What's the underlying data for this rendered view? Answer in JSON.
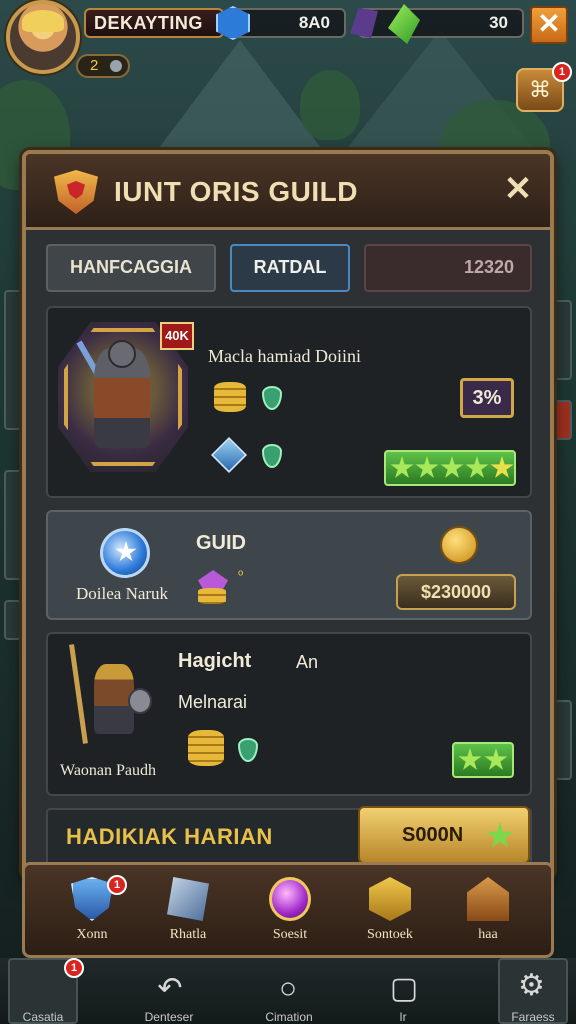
{
  "top_bar": {
    "player_name": "DEKAYTING",
    "level": "2",
    "resource_blue": "8A0",
    "resource_green": "30",
    "close_symbol": "✕",
    "mail_badge": "1"
  },
  "panel": {
    "title": "IUNT ORIS GUILD",
    "close_symbol": "✕",
    "tabs": [
      {
        "label": "HANFCAGGIA"
      },
      {
        "label": "RATDAL"
      },
      {
        "label": "12320"
      }
    ]
  },
  "cards": [
    {
      "rank_tag": "40K",
      "title": "Macla hamiad Doiini",
      "percent": "3%",
      "stars_filled": 5
    },
    {
      "title": "GUID",
      "subtitle": "Doilea Naruk",
      "small_mark": "ᵒ",
      "price": "$230000"
    },
    {
      "title": "Hagicht",
      "tag": "An",
      "subtitle": "Melnarai",
      "hero_name": "Waonan Paudh",
      "stars_filled": 2
    }
  ],
  "promo": {
    "title": "HADIKIAK HARIAN",
    "price": "S000N"
  },
  "bottom_nav": [
    {
      "label": "Xonn",
      "icon": "shield-icon",
      "badge": "1"
    },
    {
      "label": "Rhatla",
      "icon": "sword-icon"
    },
    {
      "label": "Soesit",
      "icon": "orb-icon"
    },
    {
      "label": "Sontoek",
      "icon": "gold-emblem-icon"
    },
    {
      "label": "haa",
      "icon": "house-icon"
    }
  ],
  "system_bar": {
    "left_label": "Casatia",
    "left_mid_label": "Denteser",
    "center_label": "Cimation",
    "right_mid_label": "Ir",
    "right_label": "Faraess",
    "left_badge": "1"
  },
  "colors": {
    "panel_border": "#9a7a4e",
    "accent_gold": "#e8c04a",
    "star_green": "#5ec24a"
  }
}
